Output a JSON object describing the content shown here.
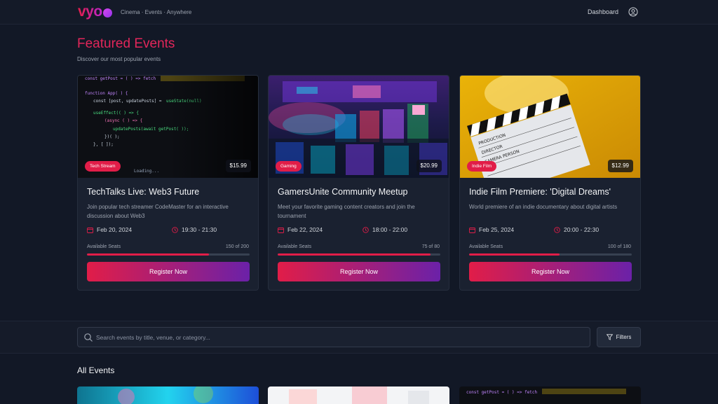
{
  "header": {
    "logo": "vyo",
    "tagline": "Cinema · Events · Anywhere",
    "nav_dashboard": "Dashboard"
  },
  "featured": {
    "title": "Featured Events",
    "subtitle": "Discover our most popular events",
    "cards": [
      {
        "badge": "Tech Stream",
        "price": "$15.99",
        "title": "TechTalks Live: Web3 Future",
        "description": "Join popular tech streamer CodeMaster for an interactive discussion about Web3",
        "date": "Feb 20, 2024",
        "time": "19:30 - 21:30",
        "seats_label": "Available Seats",
        "seats_count": "150 of 200",
        "seats_fraction": 0.75,
        "button": "Register Now"
      },
      {
        "badge": "Gaming",
        "price": "$20.99",
        "title": "GamersUnite Community Meetup",
        "description": "Meet your favorite gaming content creators and join the tournament",
        "date": "Feb 22, 2024",
        "time": "18:00 - 22:00",
        "seats_label": "Available Seats",
        "seats_count": "75 of 80",
        "seats_fraction": 0.9375,
        "button": "Register Now"
      },
      {
        "badge": "Indie Film",
        "price": "$12.99",
        "title": "Indie Film Premiere: 'Digital Dreams'",
        "description": "World premiere of an indie documentary about digital artists",
        "date": "Feb 25, 2024",
        "time": "20:00 - 22:30",
        "seats_label": "Available Seats",
        "seats_count": "100 of 180",
        "seats_fraction": 0.5556,
        "button": "Register Now"
      }
    ]
  },
  "search": {
    "placeholder": "Search events by title, venue, or category...",
    "filters_label": "Filters"
  },
  "all_events": {
    "title": "All Events"
  },
  "colors": {
    "accent": "#e11d48",
    "gradient_end": "#6b21a8",
    "background": "#121826"
  },
  "icons": [
    "user-icon",
    "calendar-icon",
    "clock-icon",
    "search-icon",
    "filter-icon"
  ]
}
